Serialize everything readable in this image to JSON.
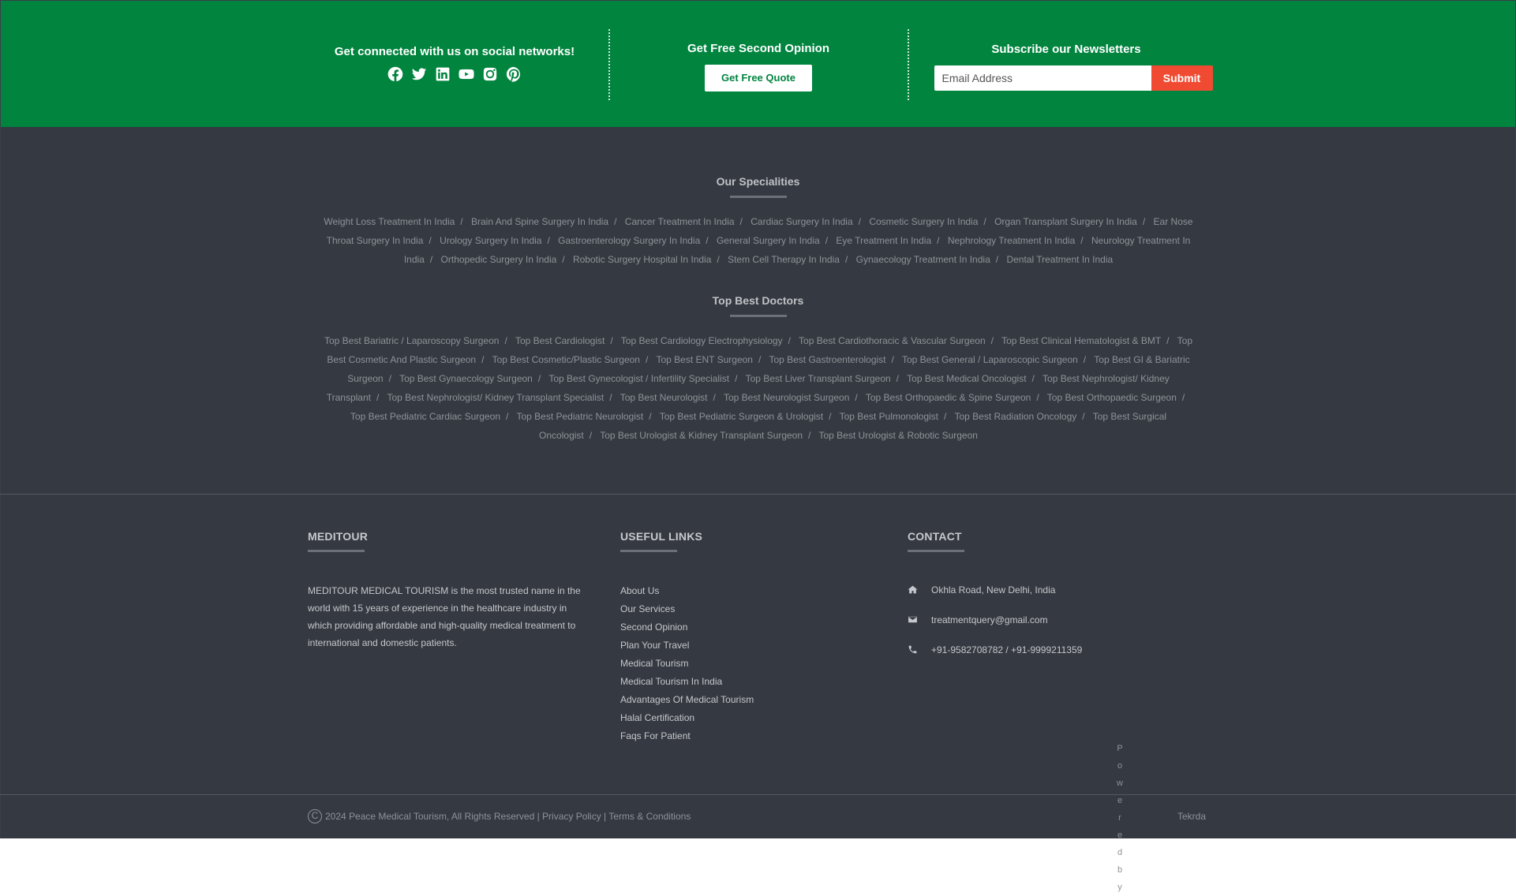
{
  "topbar": {
    "social_title": "Get connected with us on social networks!",
    "social_icons": [
      "facebook-icon",
      "twitter-icon",
      "linkedin-icon",
      "youtube-icon",
      "instagram-icon",
      "pinterest-icon"
    ],
    "opinion_title": "Get Free Second Opinion",
    "quote_button": "Get Free Quote",
    "newsletter_title": "Subscribe our Newsletters",
    "email_placeholder": "Email Address",
    "submit_button": "Submit",
    "colors": {
      "green": "#00843e",
      "submit": "#f04b32"
    }
  },
  "specialities": {
    "title": "Our Specialities",
    "items": [
      "Weight Loss Treatment In India",
      "Brain And Spine Surgery In India",
      "Cancer Treatment In India",
      "Cardiac Surgery In India",
      "Cosmetic Surgery In India",
      "Organ Transplant Surgery In India",
      "Ear Nose Throat Surgery In India",
      "Urology Surgery In India",
      "Gastroenterology Surgery In India",
      "General Surgery In India",
      "Eye Treatment In India",
      "Nephrology Treatment In India",
      "Neurology Treatment In India",
      "Orthopedic Surgery In India",
      "Robotic Surgery Hospital In India",
      "Stem Cell Therapy In India",
      "Gynaecology Treatment In India",
      "Dental Treatment In India"
    ]
  },
  "doctors": {
    "title": "Top Best Doctors",
    "items": [
      "Top Best Bariatric / Laparoscopy Surgeon",
      "Top Best Cardiologist",
      "Top Best Cardiology Electrophysiology",
      "Top Best Cardiothoracic & Vascular Surgeon",
      "Top Best Clinical Hematologist & BMT",
      "Top Best Cosmetic And Plastic Surgeon",
      "Top Best Cosmetic/Plastic Surgeon",
      "Top Best ENT Surgeon",
      "Top Best Gastroenterologist",
      "Top Best General / Laparoscopic Surgeon",
      "Top Best GI & Bariatric Surgeon",
      "Top Best Gynaecology Surgeon",
      "Top Best Gynecologist / Infertility Specialist",
      "Top Best Liver Transplant Surgeon",
      "Top Best Medical Oncologist",
      "Top Best Nephrologist/ Kidney Transplant",
      "Top Best Nephrologist/ Kidney Transplant Specialist",
      "Top Best Neurologist",
      "Top Best Neurologist Surgeon",
      "Top Best Orthopaedic & Spine Surgeon",
      "Top Best Orthopaedic Surgeon",
      "Top Best Pediatric Cardiac Surgeon",
      "Top Best Pediatric Neurologist",
      "Top Best Pediatric Surgeon & Urologist",
      "Top Best Pulmonologist",
      "Top Best Radiation Oncology",
      "Top Best Surgical Oncologist",
      "Top Best Urologist & Kidney Transplant Surgeon",
      "Top Best Urologist & Robotic Surgeon"
    ]
  },
  "footer": {
    "about_title": "MEDITOUR",
    "about_text": "MEDITOUR MEDICAL TOURISM is the most trusted name in the world with 15 years of experience in the healthcare industry in which providing affordable and high-quality medical treatment to international and domestic patients.",
    "links_title": "USEFUL LINKS",
    "links": [
      "About Us",
      "Our Services",
      "Second Opinion",
      "Plan Your Travel",
      "Medical Tourism",
      "Medical Tourism In India",
      "Advantages Of Medical Tourism",
      "Halal Certification",
      "Faqs For Patient"
    ],
    "contact_title": "CONTACT",
    "address": "Okhla Road, New Delhi, India",
    "email": "treatmentquery@gmail.com",
    "phone": "+91-9582708782 / +91-9999211359"
  },
  "bottom": {
    "copyright_symbol": "C",
    "copyright_text": "2024 Peace Medical Tourism, All Rights Reserved | Privacy Policy | Terms & Conditions",
    "powered_by_letters": [
      "P",
      "o",
      "w",
      "e",
      "r",
      "e",
      "d",
      "b",
      "y"
    ],
    "tekrda": "Tekrda"
  }
}
